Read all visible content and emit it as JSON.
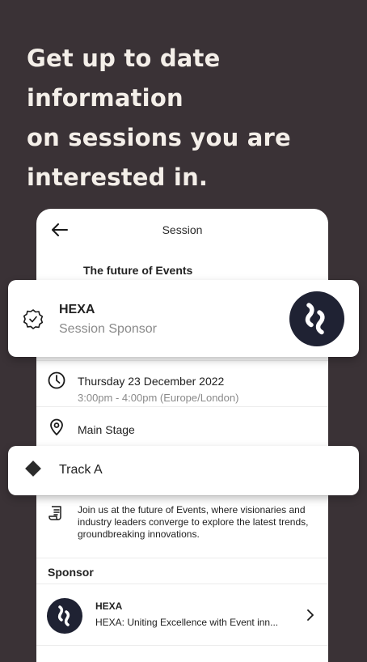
{
  "headline": {
    "line1": "Get up to date",
    "line2": "information",
    "line3": "on sessions you are",
    "line4": "interested in."
  },
  "topbar": {
    "title": "Session",
    "back_icon": "arrow-left-icon"
  },
  "session": {
    "title": "The future of Events",
    "date": "Thursday 23 December 2022",
    "time": "3:00pm - 4:00pm (Europe/London)",
    "location": "Main Stage",
    "description": "Join us at the future of Events, where visionaries and industry leaders converge to explore the latest trends, groundbreaking innovations."
  },
  "sponsor_card": {
    "name": "HEXA",
    "role": "Session Sponsor",
    "icon": "verified-badge-icon"
  },
  "track": {
    "label": "Track A",
    "icon": "diamond-icon"
  },
  "sponsors_section": {
    "heading": "Sponsor",
    "items": [
      {
        "name": "HEXA",
        "description": "HEXA: Uniting Excellence with Event inn..."
      }
    ]
  },
  "colors": {
    "background": "#3a3236",
    "headline": "#f4efe9",
    "logo": "#1f2233"
  }
}
